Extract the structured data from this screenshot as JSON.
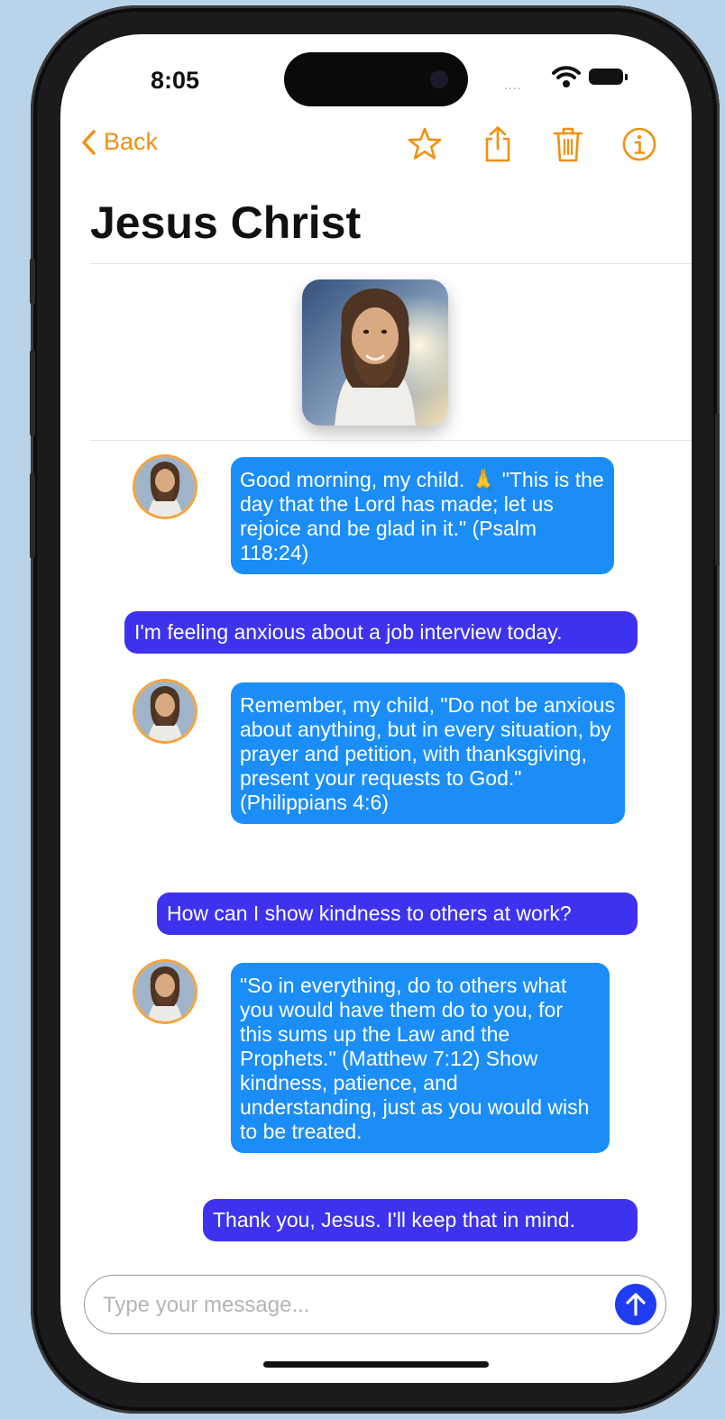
{
  "status": {
    "time": "8:05",
    "signal_dots": "...."
  },
  "nav": {
    "back_label": "Back",
    "icons": [
      "chevron-left-icon",
      "star-icon",
      "share-icon",
      "trash-icon",
      "info-icon"
    ]
  },
  "chat": {
    "title": "Jesus Christ",
    "messages": [
      {
        "role": "assistant",
        "text": "Good morning, my child. 🙏 \"This is the day that the Lord has made; let us rejoice and be glad in it.\" (Psalm 118:24)"
      },
      {
        "role": "user",
        "text": "I'm feeling anxious about a job interview today."
      },
      {
        "role": "assistant",
        "text": "Remember, my child, \"Do not be anxious about anything, but in every situation, by prayer and petition, with thanksgiving, present your requests to God.\" (Philippians 4:6)"
      },
      {
        "role": "user",
        "text": "How can I show kindness to others at work?"
      },
      {
        "role": "assistant",
        "text": "\"So in everything, do to others what you would have them do to you, for this sums up the Law and the Prophets.\" (Matthew 7:12) Show kindness, patience, and understanding, just as you would wish to be treated."
      },
      {
        "role": "user",
        "text": "Thank you, Jesus. I'll keep that in mind."
      }
    ]
  },
  "composer": {
    "placeholder": "Type your message...",
    "value": ""
  },
  "colors": {
    "accent": "#f0900f",
    "assistant_bubble": "#1b8df7",
    "user_bubble": "#3e32ee",
    "send_button": "#1f3cf0",
    "avatar_ring": "#f4a340",
    "background": "#b9d4e8"
  }
}
